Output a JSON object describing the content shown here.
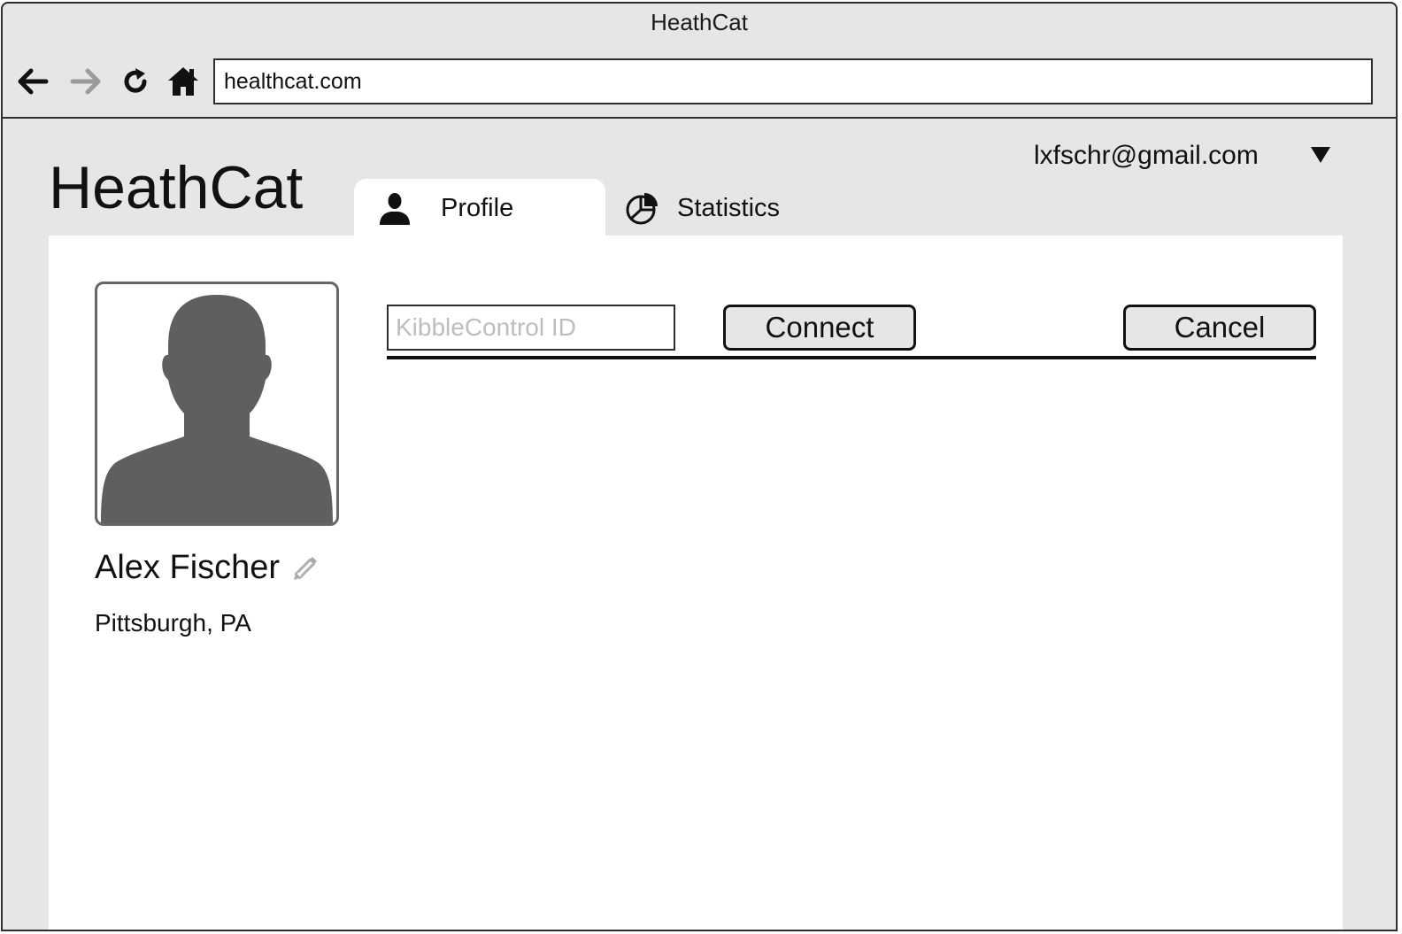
{
  "window": {
    "title": "HeathCat"
  },
  "browser": {
    "url": "healthcat.com"
  },
  "app": {
    "name": "HeathCat"
  },
  "user": {
    "email": "lxfschr@gmail.com"
  },
  "tabs": [
    {
      "label": "Profile",
      "icon": "user-icon",
      "active": true
    },
    {
      "label": "Statistics",
      "icon": "pie-chart-icon",
      "active": false
    }
  ],
  "profile": {
    "name": "Alex Fischer",
    "location": "Pittsburgh, PA"
  },
  "connect_form": {
    "input_placeholder": "KibbleControl ID",
    "input_value": "",
    "connect_label": "Connect",
    "cancel_label": "Cancel"
  },
  "colors": {
    "chrome": "#e6e6e6",
    "panel": "#ffffff",
    "silhouette": "#5f5f5f",
    "forward_disabled": "#9a9a9a"
  }
}
